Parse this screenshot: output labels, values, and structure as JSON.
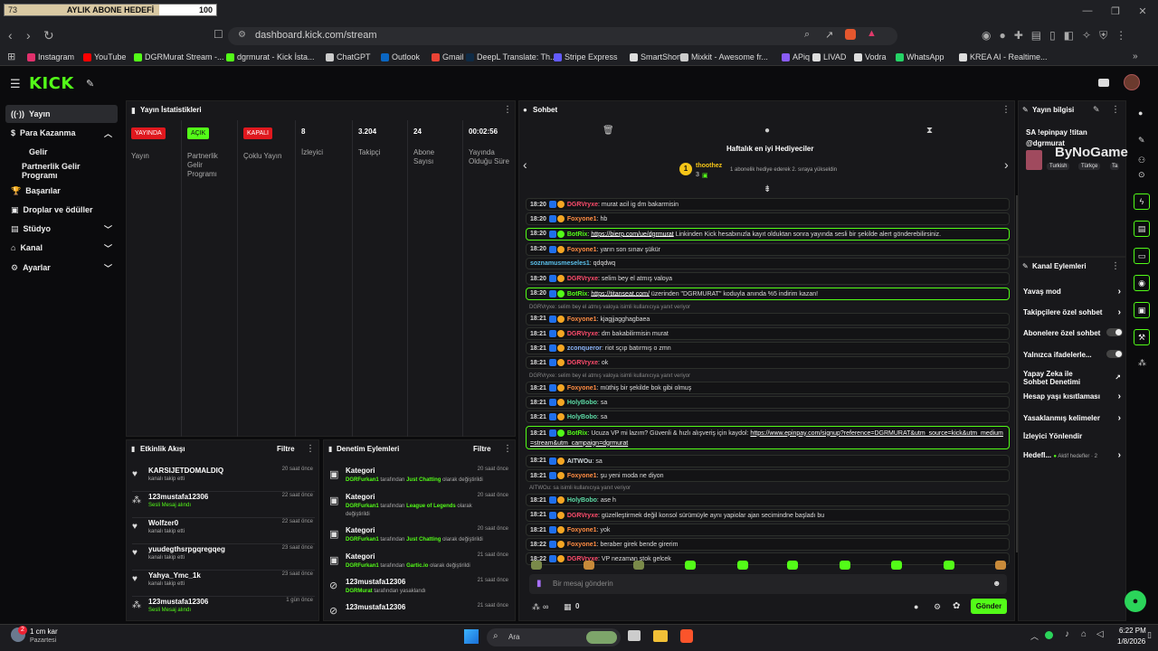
{
  "browser": {
    "goal_widget": {
      "current": "73",
      "title": "AYLIK ABONE HEDEFİ",
      "target": "100",
      "progress": 0.73
    },
    "url": "dashboard.kick.com/stream",
    "bookmarks": [
      "Instagram",
      "YouTube",
      "DGRMurat Stream -...",
      "dgrmurat - Kick İsta...",
      "ChatGPT",
      "Outlook",
      "Gmail",
      "DeepL Translate: Th...",
      "Stripe Express",
      "SmartShort",
      "Mixkit - Awesome fr...",
      "APiq",
      "LIVAD",
      "Vodra",
      "WhatsApp",
      "KREA AI - Realtime..."
    ]
  },
  "header": {
    "logo": "KICK"
  },
  "sidebar": {
    "items": [
      {
        "label": "Yayın",
        "active": true
      },
      {
        "label": "Para Kazanma"
      },
      {
        "label": "Gelir"
      },
      {
        "label": "Partnerlik Gelir Programı"
      },
      {
        "label": "Başarılar"
      },
      {
        "label": "Droplar ve ödüller"
      },
      {
        "label": "Stüdyo"
      },
      {
        "label": "Kanal"
      },
      {
        "label": "Ayarlar"
      }
    ]
  },
  "stats": {
    "title": "Yayın İstatistikleri",
    "cols": [
      {
        "badge": "YAYINDA",
        "label": "Yayın"
      },
      {
        "badge": "AÇIK",
        "label": "Partnerlik Gelir Programı"
      },
      {
        "badge": "KAPALI",
        "label": "Çoklu Yayın"
      },
      {
        "value": "8",
        "label": "İzleyici"
      },
      {
        "value": "3.204",
        "label": "Takipçi"
      },
      {
        "value": "24",
        "label": "Abone Sayısı"
      },
      {
        "value": "00:02:56",
        "label": "Yayında Olduğu Süre"
      }
    ]
  },
  "activity": {
    "title": "Etkinlik Akışı",
    "filter": "Filtre",
    "rows": [
      {
        "user": "KARSIJETDOMALDIQ",
        "sub": "kanalı takip etti",
        "time": "20 saat önce"
      },
      {
        "user": "123mustafa12306",
        "sub": "Sesli Mesaj alındı",
        "time": "22 saat önce"
      },
      {
        "user": "Wolfzer0",
        "sub": "kanalı takip etti",
        "time": "22 saat önce"
      },
      {
        "user": "yuudegthsrpgqregqeg",
        "sub": "kanalı takip etti",
        "time": "23 saat önce"
      },
      {
        "user": "Yahya_Ymc_1k",
        "sub": "kanalı takip etti",
        "time": "23 saat önce"
      },
      {
        "user": "123mustafa12306",
        "sub": "Sesli Mesaj alındı",
        "time": "1 gün önce"
      }
    ]
  },
  "moderation": {
    "title": "Denetim Eylemleri",
    "filter": "Filtre",
    "rows": [
      {
        "title": "Kategori",
        "actor": "DGRFurkan1",
        "text1": "tarafından",
        "target": "Just Chatting",
        "text2": "olarak değiştirildi",
        "time": "20 saat önce"
      },
      {
        "title": "Kategori",
        "actor": "DGRFurkan1",
        "text1": "tarafından",
        "target": "League of Legends",
        "text2": "olarak değiştirildi",
        "time": "20 saat önce"
      },
      {
        "title": "Kategori",
        "actor": "DGRFurkan1",
        "text1": "tarafından",
        "target": "Just Chatting",
        "text2": "olarak değiştirildi",
        "time": "20 saat önce"
      },
      {
        "title": "Kategori",
        "actor": "DGRFurkan1",
        "text1": "tarafından",
        "target": "Gartic.io",
        "text2": "olarak değiştirildi",
        "time": "21 saat önce"
      },
      {
        "title": "123mustafa12306",
        "actor": "DGRMurat",
        "text1": "tarafından yasaklandı",
        "target": "",
        "text2": "",
        "time": "21 saat önce"
      },
      {
        "title": "123mustafa12306",
        "actor": "",
        "text1": "",
        "target": "",
        "text2": "",
        "time": "21 saat önce"
      }
    ]
  },
  "chat": {
    "title": "Sohbet",
    "gifter_title": "Haftalık en iyi Hediyeciler",
    "gifter_name": "thoothez",
    "gifter_count": "3",
    "gifter_rank": "1",
    "gifter_note": "1 abonelik hediye ederek 2. sıraya yükseldin",
    "messages": [
      {
        "time": "18:20",
        "user": "DGRVryxe",
        "color": "#ff4d6d",
        "text": "murat acil ig dm bakarmisin"
      },
      {
        "time": "18:20",
        "user": "Foxyone1",
        "color": "#ff8c42",
        "text": "hb"
      },
      {
        "time": "18:20",
        "user": "BotRix",
        "color": "#53fc18",
        "bot": true,
        "link": "https://bierp.com/ue/dgrmurat",
        "text": " Linkinden Kick hesabınızla kayıt olduktan sonra yayında sesli bir şekilde alert gönderebilirsiniz."
      },
      {
        "time": "18:20",
        "user": "Foxyone1",
        "color": "#ff8c42",
        "text": "yarın son sınav şükür"
      },
      {
        "time": "",
        "user": "soznamusmeseles1",
        "color": "#5bc0eb",
        "text": "qdqdwq"
      },
      {
        "time": "18:20",
        "user": "DGRVryxe",
        "color": "#ff4d6d",
        "text": "selim bey el atmış valoya"
      },
      {
        "time": "18:20",
        "user": "BotRix",
        "color": "#53fc18",
        "bot": true,
        "link": "https://titanseat.com/",
        "text": " üzerinden \"DGRMURAT\" koduyla anında %5 indirim kazan!"
      },
      {
        "time": "18:21",
        "user": "Foxyone1",
        "color": "#ff8c42",
        "text": "kjagjjagghagbaea",
        "reply": "DGRVryxe: selim bey el atmış valoya isimli kullanıcıya yanıt veriyor"
      },
      {
        "time": "18:21",
        "user": "DGRVryxe",
        "color": "#ff4d6d",
        "text": "dm bakabilirmisin murat"
      },
      {
        "time": "18:21",
        "user": "zconqueror",
        "color": "#8ab4f8",
        "text": "riot sçıp batırmış o zmn"
      },
      {
        "time": "18:21",
        "user": "DGRVryxe",
        "color": "#ff4d6d",
        "text": "ok"
      },
      {
        "time": "18:21",
        "user": "Foxyone1",
        "color": "#ff8c42",
        "text": "müthiş bir şekilde bok gibi olmuş",
        "reply": "DGRVryxe: selim bey el atmış valoya isimli kullanıcıya yanıt veriyor"
      },
      {
        "time": "18:21",
        "user": "HolyBobo",
        "color": "#5cd9a4",
        "text": "sa"
      },
      {
        "time": "18:21",
        "user": "HolyBobo",
        "color": "#5cd9a4",
        "text": "sa"
      },
      {
        "time": "18:21",
        "user": "BotRix",
        "color": "#53fc18",
        "bot": true,
        "text": "Ucuza VP mi lazım? Güvenli & hızlı alışveriş için kaydol:",
        "link": "https://www.epinpay.com/signup?reference=DGRMURAT&utm_source=kick&utm_medium=stream&utm_campaign=dgrmurat"
      },
      {
        "time": "18:21",
        "user": "AITWOu",
        "color": "#cfd8dc",
        "text": "sa"
      },
      {
        "time": "18:21",
        "user": "Foxyone1",
        "color": "#ff8c42",
        "text": "şu yeni moda ne diyon"
      },
      {
        "time": "18:21",
        "user": "HolyBobo",
        "color": "#5cd9a4",
        "text": "ase h",
        "reply": "AITWOu: sa isimli kullanıcıya yanıt veriyor"
      },
      {
        "time": "18:21",
        "user": "DGRVryxe",
        "color": "#ff4d6d",
        "text": "güzelleştirmek değil konsol sürümüyle aynı yapiolar ajan secimindne başladı bu"
      },
      {
        "time": "18:21",
        "user": "Foxyone1",
        "color": "#ff8c42",
        "text": "yok"
      },
      {
        "time": "18:22",
        "user": "Foxyone1",
        "color": "#ff8c42",
        "text": "beraber girek bende girerim"
      },
      {
        "time": "18:22",
        "user": "DGRVryxe",
        "color": "#ff4d6d",
        "text": "VP nezaman stok gelcek"
      }
    ],
    "input_placeholder": "Bir mesaj gönderin",
    "points": "∞",
    "gift_count": "0",
    "send_label": "Gönder"
  },
  "stream_info": {
    "title": "Yayın bilgisi",
    "stream_title": "SA !epinpay !titan @dgrmurat",
    "tags": [
      "Turkish",
      "Türkçe",
      "Ta"
    ],
    "watermark": "ByNoGame"
  },
  "channel_actions": {
    "title": "Kanal Eylemleri",
    "items": [
      {
        "label": "Yavaş mod",
        "kind": "chevron"
      },
      {
        "label": "Takipçilere özel sohbet",
        "kind": "chevron"
      },
      {
        "label": "Abonelere özel sohbet",
        "kind": "toggle"
      },
      {
        "label": "Yalnızca ifadelerle...",
        "kind": "toggle"
      },
      {
        "label": "Yapay Zeka ile Sohbet Denetimi",
        "kind": "external"
      },
      {
        "label": "Hesap yaşı kısıtlaması",
        "kind": "chevron"
      },
      {
        "label": "Yasaklanmış kelimeler",
        "kind": "chevron"
      },
      {
        "label": "İzleyici Yönlendir",
        "kind": "none"
      },
      {
        "label": "Hedefl...",
        "kind": "chevron",
        "extra": "Aktif hedefler · 2"
      }
    ]
  },
  "taskbar": {
    "weather": "1 cm kar",
    "weather_sub": "Pazartesi",
    "search": "Ara",
    "time": "6:22 PM",
    "date": "1/8/2026",
    "notif": "2"
  }
}
